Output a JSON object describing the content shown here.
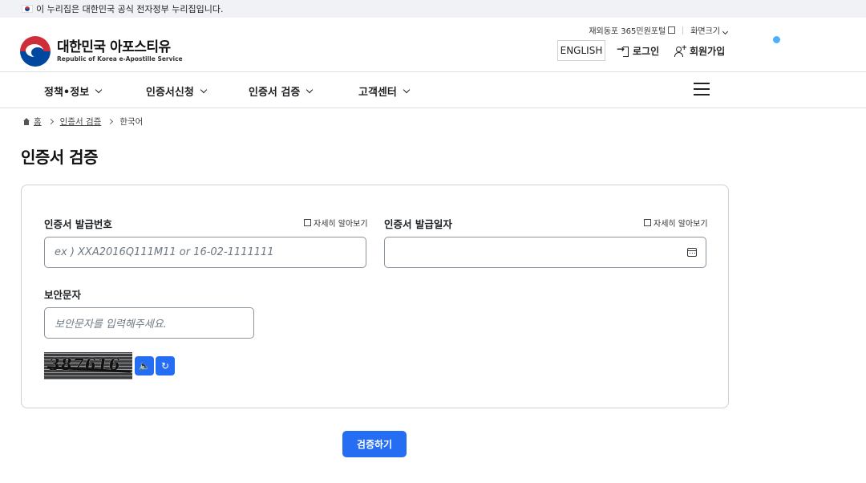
{
  "gov_banner": {
    "text": "이 누리집은 대한민국 공식 전자정부 누리집입니다."
  },
  "logo": {
    "title": "대한민국 아포스티유",
    "subtitle": "Republic of Korea e-Apostille Service"
  },
  "utility": {
    "overseas_portal": "재외동포 365민원포털",
    "font_size": "화면크기"
  },
  "header_actions": {
    "language": "ENGLISH",
    "login": "로그인",
    "signup": "회원가입"
  },
  "gnb": {
    "items": [
      {
        "label": "정책•정보"
      },
      {
        "label": "인증서신청"
      },
      {
        "label": "인증서 검증"
      },
      {
        "label": "고객센터"
      }
    ]
  },
  "breadcrumb": {
    "home": "홈",
    "section": "인증서 검증",
    "current": "한국어"
  },
  "page": {
    "title": "인증서 검증"
  },
  "form": {
    "cert_number": {
      "label": "인증서 발급번호",
      "more": "자세히 알아보기",
      "placeholder": "ex ) XXA2016Q111M11 or 16-02-1111111"
    },
    "issue_date": {
      "label": "인증서 발급일자",
      "more": "자세히 알아보기",
      "value": ""
    },
    "security": {
      "label": "보안문자",
      "placeholder": "보안문자를 입력해주세요."
    },
    "captcha_text": "387616"
  },
  "submit": {
    "label": "검증하기"
  },
  "colors": {
    "primary": "#256ef4",
    "accent_dot": "#4dafff"
  }
}
